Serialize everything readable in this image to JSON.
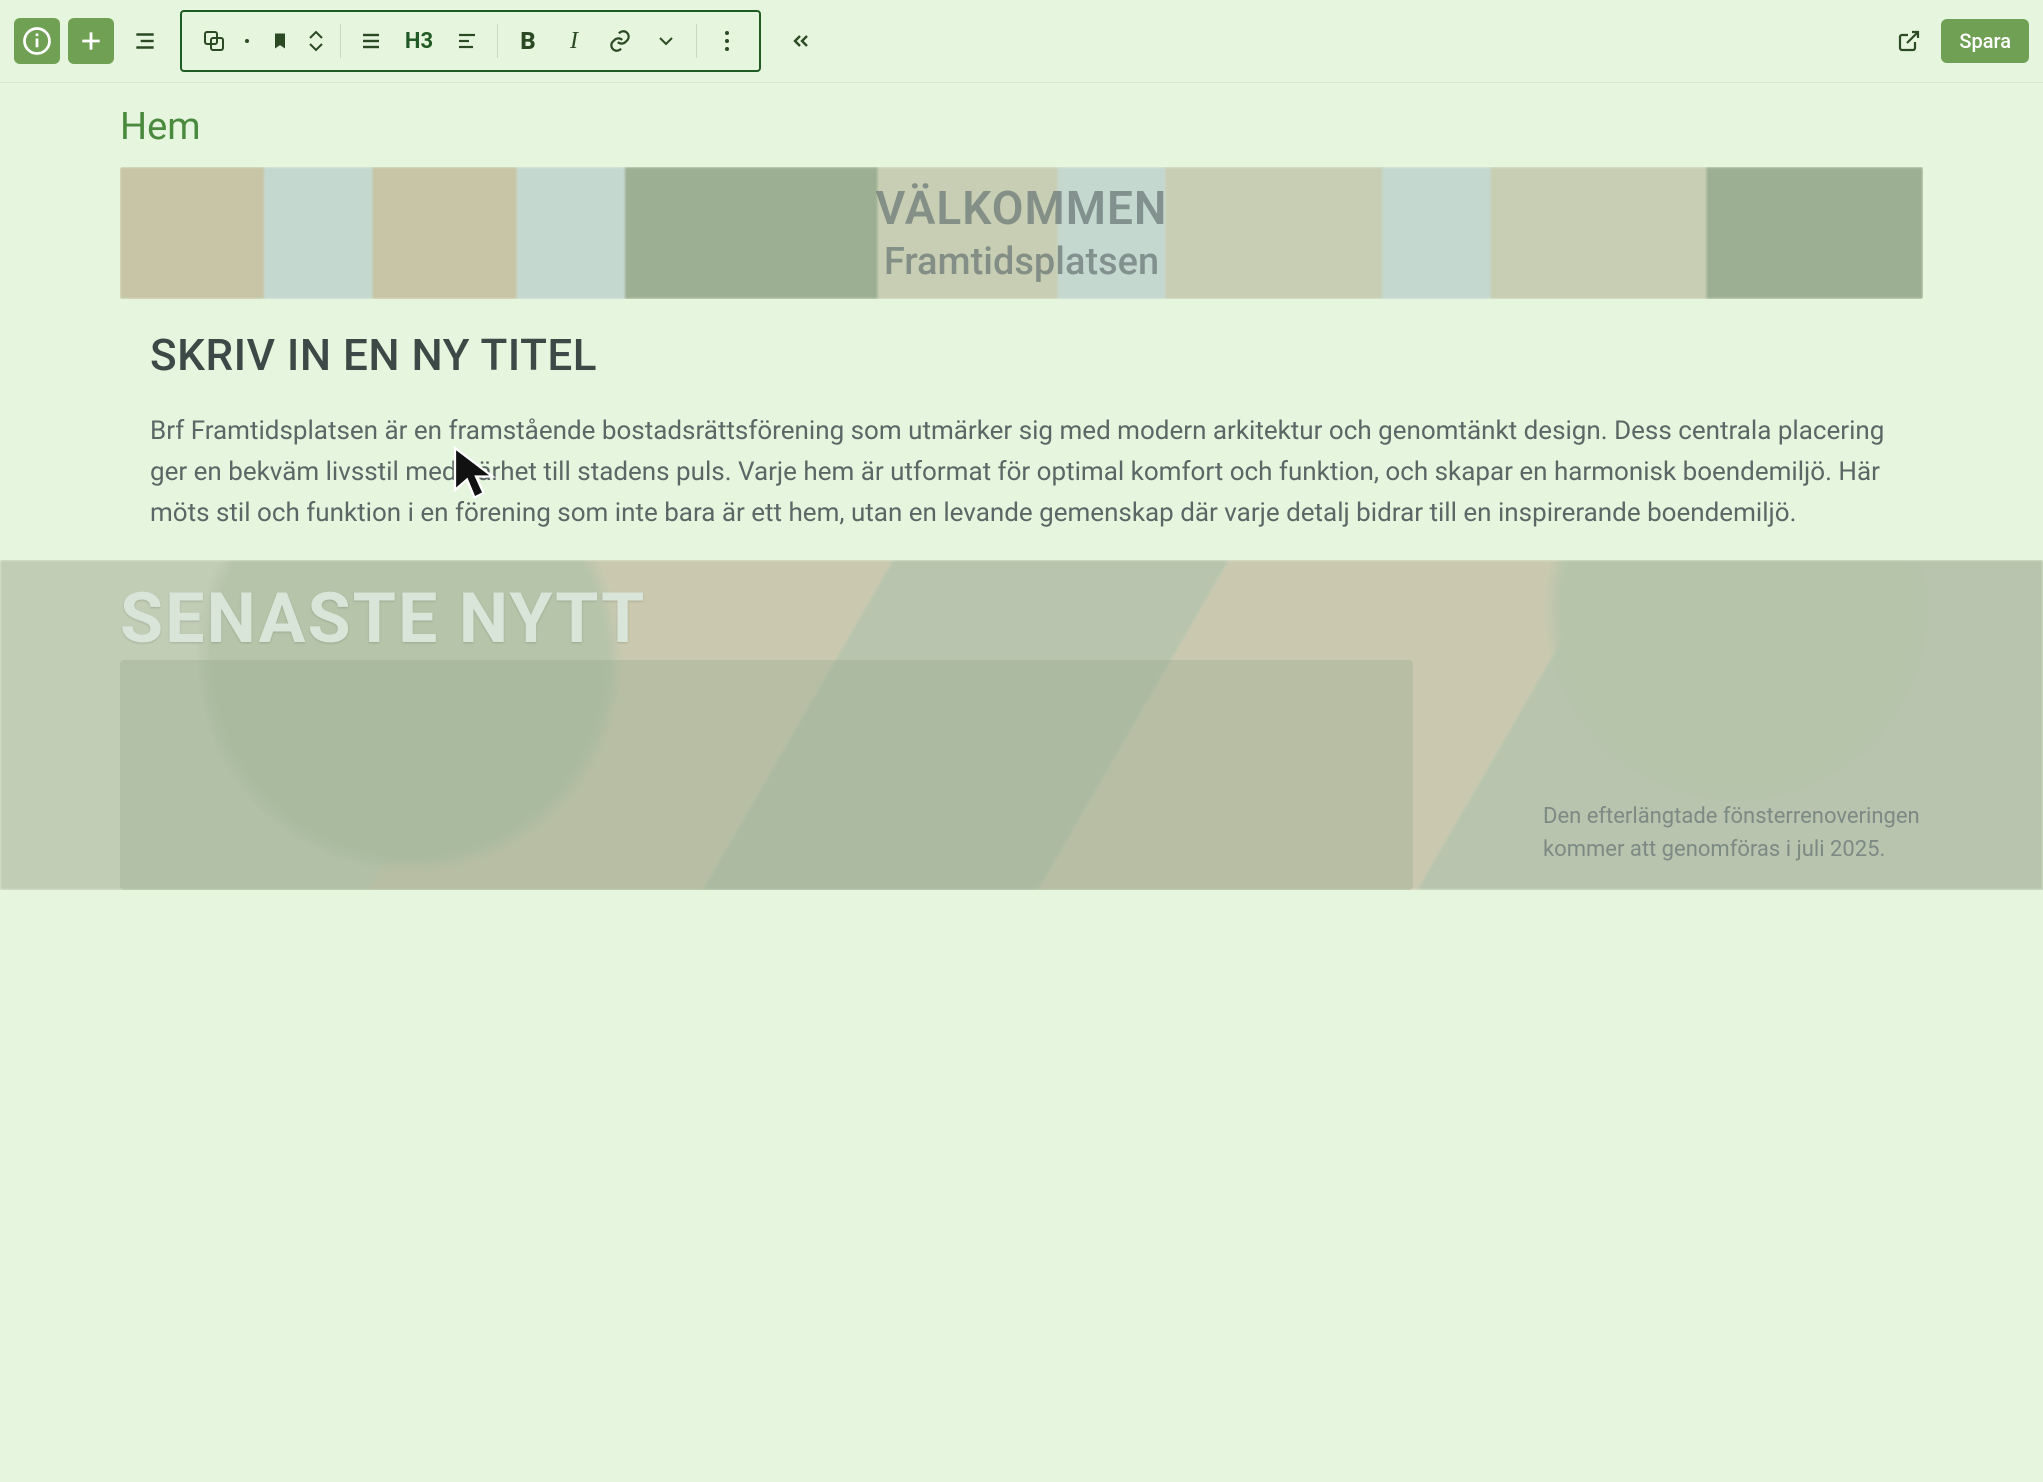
{
  "toolbar": {
    "info_icon": "info",
    "add_icon": "plus",
    "outline_icon": "outline",
    "heading_label": "H3",
    "save_label": "Spara"
  },
  "breadcrumb": "Hem",
  "hero": {
    "title": "VÄLKOMMEN",
    "subtitle": "Framtidsplatsen"
  },
  "editor": {
    "new_title": "SKRIV IN EN NY TITEL",
    "body": "Brf Framtidsplatsen är en framstående bostadsrättsförening som utmärker sig med modern arkitektur och genomtänkt design. Dess centrala placering ger en bekväm livsstil med närhet till stadens puls. Varje hem är utformat för optimal komfort och funktion, och skapar en harmonisk boendemiljö. Här möts stil och funktion i en förening som inte bara är ett hem, utan en levande gemenskap där varje detalj bidrar till en inspirerande boendemiljö."
  },
  "news": {
    "heading": "SENASTE NYTT",
    "snippet": "Den efterlängtade fönsterrenoveringen kommer att genomföras i juli 2025."
  }
}
